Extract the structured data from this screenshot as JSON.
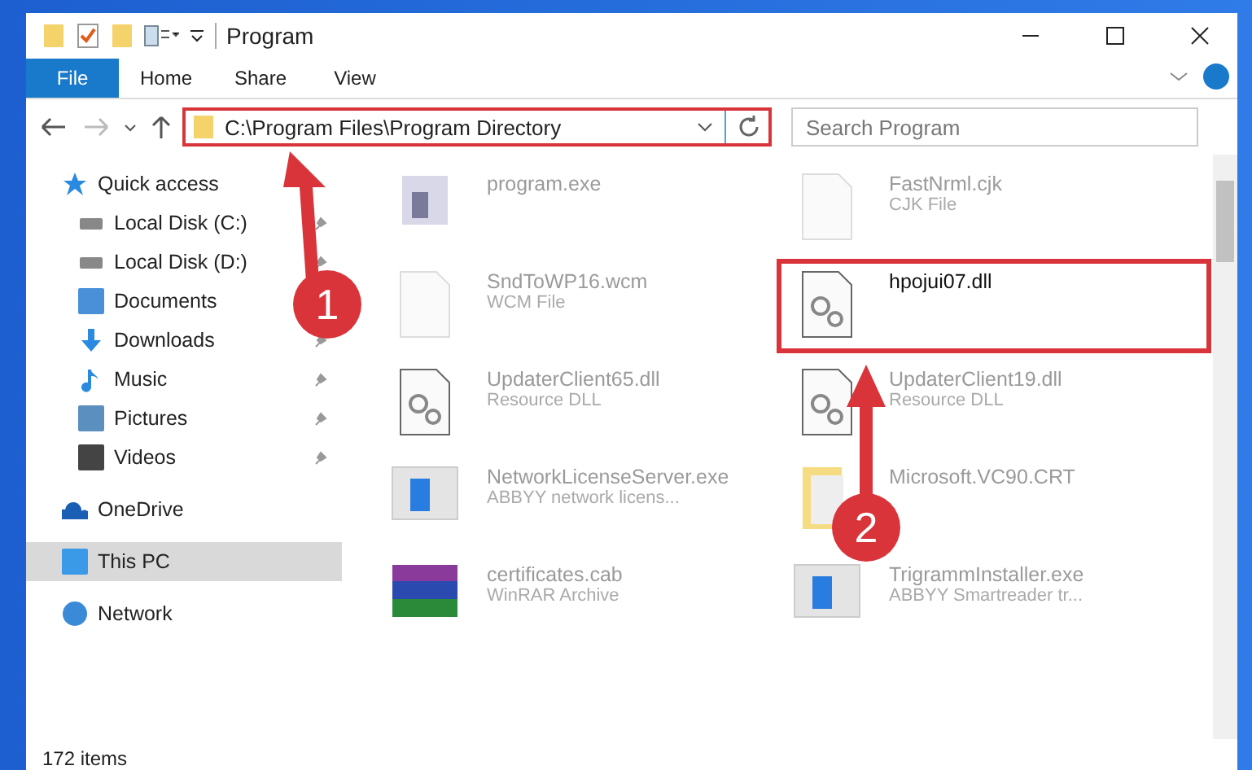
{
  "window": {
    "title": "Program"
  },
  "ribbon_tabs": [
    {
      "label": "File",
      "selected": true
    },
    {
      "label": "Home",
      "selected": false
    },
    {
      "label": "Share",
      "selected": false
    },
    {
      "label": "View",
      "selected": false
    }
  ],
  "address": {
    "path": "C:\\Program Files\\Program Directory"
  },
  "search": {
    "placeholder": "Search Program"
  },
  "sidebar": {
    "items": [
      {
        "label": "Quick access",
        "selected": false,
        "children": [
          {
            "label": "Local Disk (C:)",
            "pinned": true,
            "selected": false
          },
          {
            "label": "Local Disk (D:)",
            "pinned": true,
            "selected": false
          },
          {
            "label": "Documents",
            "selected": false
          },
          {
            "label": "Downloads",
            "pinned": true,
            "selected": false
          },
          {
            "label": "Music",
            "pinned": true,
            "selected": false
          },
          {
            "label": "Pictures",
            "pinned": true,
            "selected": false
          },
          {
            "label": "Videos",
            "pinned": true,
            "selected": false
          }
        ]
      },
      {
        "label": "OneDrive",
        "selected": false
      },
      {
        "label": "This PC",
        "selected": true
      },
      {
        "label": "Network",
        "selected": false
      }
    ]
  },
  "files": [
    {
      "name": "program.exe",
      "kind": "exe",
      "highlighted": false
    },
    {
      "name": "FastNrml.cjk",
      "type": "CJK File",
      "kind": "blank",
      "highlighted": false
    },
    {
      "name": "SndToWP16.wcm",
      "type": "WCM File",
      "kind": "blank",
      "highlighted": false
    },
    {
      "name": "hpojui07.dll",
      "kind": "dll",
      "highlighted": true
    },
    {
      "name": "UpdaterClient65.dll",
      "type": "Resource DLL",
      "kind": "dll",
      "highlighted": false
    },
    {
      "name": "UpdaterClient19.dll",
      "type": "Resource DLL",
      "kind": "dll",
      "highlighted": false
    },
    {
      "name": "NetworkLicenseServer.exe",
      "type": "ABBYY network licens...",
      "kind": "app",
      "highlighted": false
    },
    {
      "name": "Microsoft.VC90.CRT",
      "kind": "folder",
      "highlighted": false
    },
    {
      "name": "certificates.cab",
      "type": "WinRAR Archive",
      "kind": "rar",
      "highlighted": false
    },
    {
      "name": "TrigrammInstaller.exe",
      "type": "ABBYY Smartreader tr...",
      "kind": "app",
      "highlighted": false
    }
  ],
  "status_bar": {
    "count": "172 items"
  },
  "callouts": [
    {
      "number": "1"
    },
    {
      "number": "2"
    }
  ]
}
